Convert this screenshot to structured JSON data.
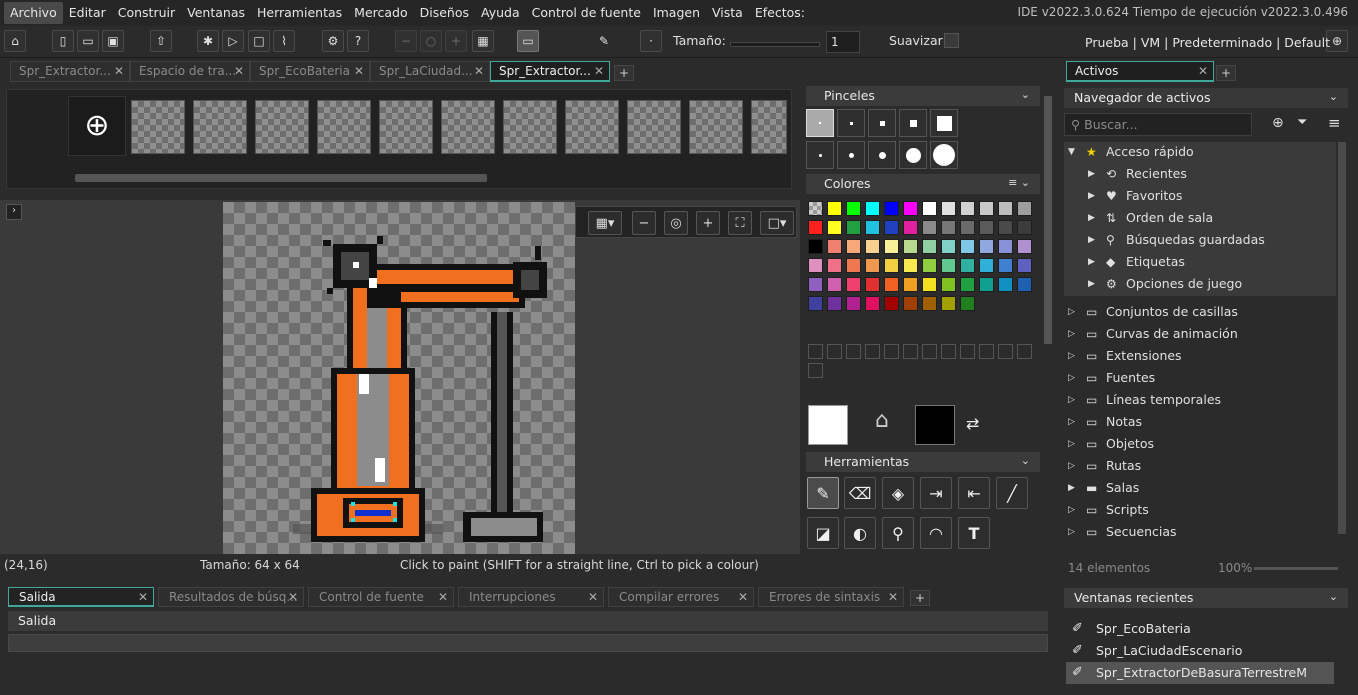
{
  "menubar": {
    "items": [
      "Archivo",
      "Editar",
      "Construir",
      "Ventanas",
      "Herramientas",
      "Mercado",
      "Diseños",
      "Ayuda",
      "Control de fuente",
      "Imagen",
      "Vista",
      "Efectos:"
    ],
    "version": "IDE v2022.3.0.624  Tiempo de ejecución v2022.3.0.496"
  },
  "toolbar": {
    "size_label": "Tamaño:",
    "size_value": "1",
    "smooth_label": "Suavizar",
    "targets": "Prueba  |  VM  |  Predeterminado  |  Default"
  },
  "doc_tabs": [
    "Spr_Extractor...",
    "Espacio de tra...",
    "Spr_EcoBateria",
    "Spr_LaCiudad...",
    "Spr_Extractor..."
  ],
  "status": {
    "coords": "(24,16)",
    "size": "Tamaño: 64 x 64",
    "hint": "Click to paint (SHIFT for a straight line, Ctrl to pick a colour)"
  },
  "panels": {
    "brushes": "Pinceles",
    "colors": "Colores",
    "tools": "Herramientas"
  },
  "palette": [
    "#ffff00",
    "#00ff00",
    "#00ffff",
    "#0000ff",
    "#ff00ff",
    "#ffffff",
    "#e0e0e0",
    "#d0d0d0",
    "#c8c8c8",
    "#bdbdbd",
    "#9e9e9e",
    "#ff2020",
    "#ffff20",
    "#20a040",
    "#20c0e0",
    "#2040c0",
    "#e020a0",
    "#8a8a8a",
    "#777777",
    "#6a6a6a",
    "#5a5a5a",
    "#4a4a4a",
    "#3c3c3c",
    "#000000",
    "#f08070",
    "#f8a878",
    "#f8d090",
    "#f8f098",
    "#b8d890",
    "#90d0a0",
    "#80d0c8",
    "#80c8e8",
    "#90a8e0",
    "#8890d8",
    "#b090d0",
    "#e090c0",
    "#f07088",
    "#f07850",
    "#f09850",
    "#f0d040",
    "#f8e850",
    "#90d040",
    "#60c890",
    "#30b0a0",
    "#30b0d8",
    "#4080d0",
    "#6060c0",
    "#9060c0",
    "#d060b0",
    "#f04070",
    "#e03030",
    "#f06020",
    "#f0a020",
    "#f0e020",
    "#80c020",
    "#20a040",
    "#10a090",
    "#1090c0",
    "#2060b0",
    "#4040a0",
    "#7030a0",
    "#b02090",
    "#e01060",
    "#a00000",
    "#a04000",
    "#a06000",
    "#a0a000",
    "#208020"
  ],
  "assets": {
    "tab": "Activos",
    "header": "Navegador de activos",
    "search_placeholder": "Buscar...",
    "quick_access": "Acceso rápido",
    "quick_items": [
      "Recientes",
      "Favoritos",
      "Orden de sala",
      "Búsquedas guardadas",
      "Etiquetas",
      "Opciones de juego"
    ],
    "folders": [
      "Conjuntos de casillas",
      "Curvas de animación",
      "Extensiones",
      "Fuentes",
      "Líneas temporales",
      "Notas",
      "Objetos",
      "Rutas",
      "Salas",
      "Scripts",
      "Secuencias"
    ],
    "count": "14 elementos",
    "zoom": "100%"
  },
  "recent_windows": {
    "header": "Ventanas recientes",
    "items": [
      "Spr_EcoBateria",
      "Spr_LaCiudadEscenario",
      "Spr_ExtractorDeBasuraTerrestreM"
    ]
  },
  "output": {
    "tabs": [
      "Salida",
      "Resultados de búsq...",
      "Control de fuente",
      "Interrupciones",
      "Compilar errores",
      "Errores de sintaxis"
    ],
    "header": "Salida"
  },
  "colors": {
    "accent": "#3fa89b",
    "arm": "#f07020",
    "outline": "#111111"
  }
}
